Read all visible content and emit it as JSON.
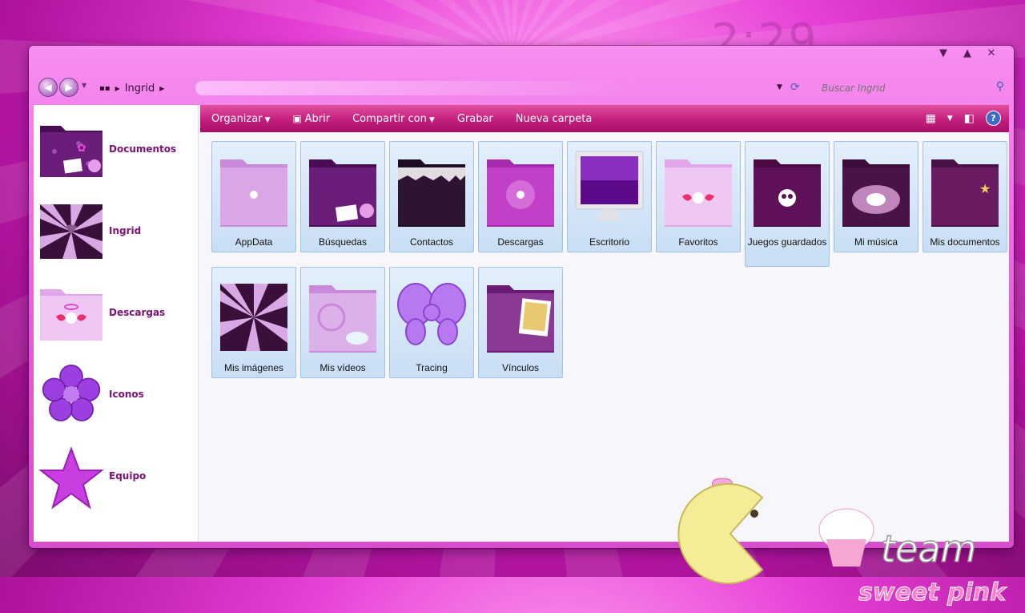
{
  "desktop": {
    "clock": "2:29"
  },
  "window": {
    "caption_buttons": [
      "▼",
      "▲",
      "✕"
    ],
    "breadcrumb": [
      "Ingrid"
    ],
    "search_placeholder": "Buscar Ingrid"
  },
  "toolbar": {
    "organize": "Organizar",
    "open": "Abrir",
    "share": "Compartir con",
    "burn": "Grabar",
    "new_folder": "Nueva carpeta"
  },
  "sidebar": {
    "items": [
      {
        "label": "Documentos",
        "icon": "folder-purple-icon"
      },
      {
        "label": "Ingrid",
        "icon": "striped-folder-icon"
      },
      {
        "label": "Descargas",
        "icon": "angel-folder-icon"
      },
      {
        "label": "Iconos",
        "icon": "flower-icon"
      },
      {
        "label": "Equipo",
        "icon": "star-icon"
      }
    ]
  },
  "files": [
    {
      "name": "AppData",
      "icon": "folder-icon"
    },
    {
      "name": "Búsquedas",
      "icon": "folder-icon"
    },
    {
      "name": "Contactos",
      "icon": "folder-icon"
    },
    {
      "name": "Descargas",
      "icon": "folder-icon"
    },
    {
      "name": "Escritorio",
      "icon": "monitor-icon"
    },
    {
      "name": "Favoritos",
      "icon": "folder-icon"
    },
    {
      "name": "Juegos guardados",
      "icon": "skull-folder-icon"
    },
    {
      "name": "Mi música",
      "icon": "folder-icon"
    },
    {
      "name": "Mis documentos",
      "icon": "folder-icon"
    },
    {
      "name": "Mis imágenes",
      "icon": "folder-icon"
    },
    {
      "name": "Mis vídeos",
      "icon": "folder-icon"
    },
    {
      "name": "Tracing",
      "icon": "bow-icon"
    },
    {
      "name": "Vínculos",
      "icon": "folder-icon"
    }
  ],
  "watermark": {
    "line1": "team",
    "line2": "sweet pink"
  },
  "colors": {
    "accent": "#c41e7e",
    "desktop": "#e63fd5",
    "folder_dark": "#5a1360",
    "folder_light": "#d38be0",
    "tile_selected": "#c9def4"
  }
}
